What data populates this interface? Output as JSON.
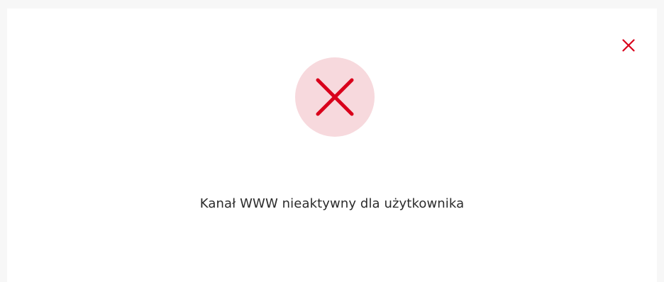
{
  "dialog": {
    "message": "Kanał WWW nieaktywny dla użytkownika",
    "close_icon": "close-icon",
    "status_icon": "error-x-icon"
  },
  "colors": {
    "accent": "#d9001b",
    "status_bg": "#f7d9dd",
    "text": "#2b2b2b"
  }
}
